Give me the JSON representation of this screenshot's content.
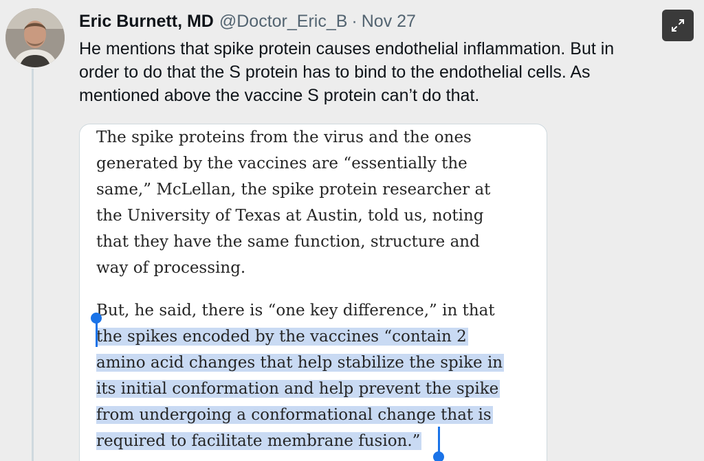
{
  "tweet": {
    "author_name": "Eric Burnett, MD",
    "handle": "@Doctor_Eric_B",
    "separator": "·",
    "date": "Nov 27",
    "body_lines": [
      "He mentions that spike protein causes endothelial inflammation. But in",
      "order to do that the S protein has to bind to the endothelial cells. As",
      "mentioned above the vaccine S protein can’t do that."
    ]
  },
  "quote": {
    "paragraph1": [
      "The spike proteins from the virus and the ones",
      "generated by the vaccines are “essentially the",
      "same,” McLellan, the spike protein researcher at",
      "the University of Texas at Austin, told us, noting",
      "that they have the same function, structure and",
      "way of processing."
    ],
    "paragraph2_first_line": "But, he said, there is “one key difference,” in that",
    "paragraph2_selected": [
      "the spikes encoded by the vaccines “contain 2",
      "amino acid changes that help stabilize the spike in",
      "its initial conformation and help prevent the spike",
      "from undergoing a conformational change that is",
      "required to facilitate membrane fusion.”"
    ]
  },
  "colors": {
    "selection_highlight": "#c9daf3",
    "selection_handle": "#1a73e8"
  },
  "icons": {
    "expand": "expand-arrows-icon",
    "avatar": "avatar"
  }
}
